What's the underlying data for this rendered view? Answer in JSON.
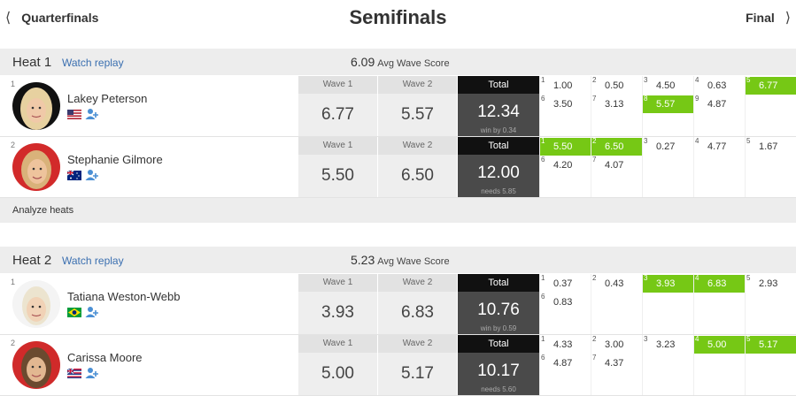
{
  "nav": {
    "prev_label": "Quarterfinals",
    "title": "Semifinals",
    "next_label": "Final"
  },
  "columns": {
    "wave1": "Wave 1",
    "wave2": "Wave 2",
    "total": "Total"
  },
  "analyze_label": "Analyze heats",
  "colors": {
    "highlight": "#76c815",
    "total_bg": "#4a4a4a",
    "link": "#3a6fb0"
  },
  "heats": [
    {
      "label": "Heat 1",
      "replay": "Watch replay",
      "avg_value": "6.09",
      "avg_label": "Avg Wave Score",
      "surfers": [
        {
          "seed": "1",
          "name": "Lakey Peterson",
          "country": "USA",
          "flag_icon": "flag-usa-icon",
          "wave1": "6.77",
          "wave2": "5.57",
          "total": "12.34",
          "note": "win by 0.34",
          "waves": [
            {
              "n": "1",
              "v": "1.00",
              "best": false
            },
            {
              "n": "2",
              "v": "0.50",
              "best": false
            },
            {
              "n": "3",
              "v": "4.50",
              "best": false
            },
            {
              "n": "4",
              "v": "0.63",
              "best": false
            },
            {
              "n": "5",
              "v": "6.77",
              "best": true
            },
            {
              "n": "6",
              "v": "3.50",
              "best": false
            },
            {
              "n": "7",
              "v": "3.13",
              "best": false
            },
            {
              "n": "8",
              "v": "5.57",
              "best": true
            },
            {
              "n": "9",
              "v": "4.87",
              "best": false
            }
          ]
        },
        {
          "seed": "2",
          "name": "Stephanie Gilmore",
          "country": "Australia",
          "flag_icon": "flag-australia-icon",
          "wave1": "5.50",
          "wave2": "6.50",
          "total": "12.00",
          "note": "needs 5.85",
          "waves": [
            {
              "n": "1",
              "v": "5.50",
              "best": true
            },
            {
              "n": "2",
              "v": "6.50",
              "best": true
            },
            {
              "n": "3",
              "v": "0.27",
              "best": false
            },
            {
              "n": "4",
              "v": "4.77",
              "best": false
            },
            {
              "n": "5",
              "v": "1.67",
              "best": false
            },
            {
              "n": "6",
              "v": "4.20",
              "best": false
            },
            {
              "n": "7",
              "v": "4.07",
              "best": false
            }
          ]
        }
      ]
    },
    {
      "label": "Heat 2",
      "replay": "Watch replay",
      "avg_value": "5.23",
      "avg_label": "Avg Wave Score",
      "surfers": [
        {
          "seed": "1",
          "name": "Tatiana Weston-Webb",
          "country": "Brazil",
          "flag_icon": "flag-brazil-icon",
          "wave1": "3.93",
          "wave2": "6.83",
          "total": "10.76",
          "note": "win by 0.59",
          "waves": [
            {
              "n": "1",
              "v": "0.37",
              "best": false
            },
            {
              "n": "2",
              "v": "0.43",
              "best": false
            },
            {
              "n": "3",
              "v": "3.93",
              "best": true
            },
            {
              "n": "4",
              "v": "6.83",
              "best": true
            },
            {
              "n": "5",
              "v": "2.93",
              "best": false
            },
            {
              "n": "6",
              "v": "0.83",
              "best": false
            }
          ]
        },
        {
          "seed": "2",
          "name": "Carissa Moore",
          "country": "Hawaii",
          "flag_icon": "flag-hawaii-icon",
          "wave1": "5.00",
          "wave2": "5.17",
          "total": "10.17",
          "note": "needs 5.60",
          "waves": [
            {
              "n": "1",
              "v": "4.33",
              "best": false
            },
            {
              "n": "2",
              "v": "3.00",
              "best": false
            },
            {
              "n": "3",
              "v": "3.23",
              "best": false
            },
            {
              "n": "4",
              "v": "5.00",
              "best": true
            },
            {
              "n": "5",
              "v": "5.17",
              "best": true
            },
            {
              "n": "6",
              "v": "4.87",
              "best": false
            },
            {
              "n": "7",
              "v": "4.37",
              "best": false
            }
          ]
        }
      ]
    }
  ]
}
